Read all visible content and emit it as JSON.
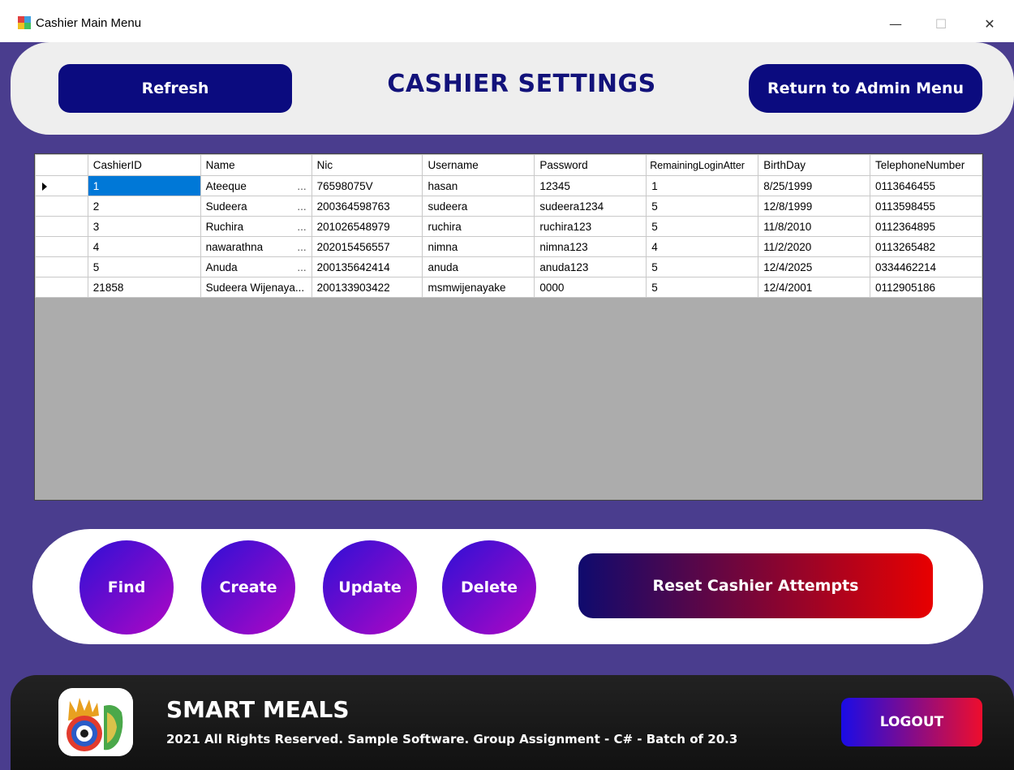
{
  "window": {
    "title": "Cashier Main Menu",
    "min_symbol": "—",
    "max_symbol": "☐",
    "close_symbol": "✕"
  },
  "header": {
    "refresh_label": "Refresh",
    "title": "CASHIER SETTINGS",
    "return_label": "Return to Admin Menu"
  },
  "table": {
    "columns": [
      "CashierID",
      "Name",
      "Nic",
      "Username",
      "Password",
      "RemainingLoginAtter",
      "BirthDay",
      "TelephoneNumber"
    ],
    "rows": [
      [
        "1",
        "Ateeque",
        "76598075V",
        "hasan",
        "12345",
        "1",
        "8/25/1999",
        "0113646455"
      ],
      [
        "2",
        "Sudeera",
        "200364598763",
        "sudeera",
        "sudeera1234",
        "5",
        "12/8/1999",
        "0113598455"
      ],
      [
        "3",
        "Ruchira",
        "201026548979",
        "ruchira",
        "ruchira123",
        "5",
        "11/8/2010",
        "0112364895"
      ],
      [
        "4",
        "nawarathna",
        "202015456557",
        "nimna",
        "nimna123",
        "4",
        "11/2/2020",
        "0113265482"
      ],
      [
        "5",
        "Anuda",
        "200135642414",
        "anuda",
        "anuda123",
        "5",
        "12/4/2025",
        "0334462214"
      ],
      [
        "21858",
        "Sudeera Wijenaya...",
        "200133903422",
        "msmwijenayake",
        "0000",
        "5",
        "12/4/2001",
        "0112905186"
      ]
    ],
    "name_ellipsis": "..."
  },
  "actions": {
    "find": "Find",
    "create": "Create",
    "update": "Update",
    "delete": "Delete",
    "reset": "Reset Cashier Attempts"
  },
  "footer": {
    "brand": "SMART MEALS",
    "copyright": "2021 All Rights Reserved.  Sample Software. Group Assignment - C# - Batch of 20.3",
    "logout": "LOGOUT"
  },
  "colors": {
    "background": "#4a3d8e",
    "primary_button": "#0b0b7f",
    "title_text": "#12127a",
    "selection": "#0078d7"
  }
}
